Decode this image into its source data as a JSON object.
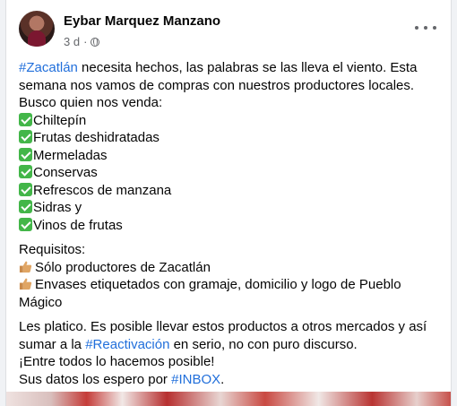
{
  "post": {
    "author": "Eybar Marquez Manzano",
    "time": "3 d",
    "dot": "·",
    "line1_tag": "#Zacatlán",
    "line1_rest": " necesita hechos, las palabras se las lleva el viento. Esta",
    "line2": "semana nos vamos de compras con nuestros productores locales.",
    "line3": "Busco quien nos venda:",
    "items": [
      "Chiltepín",
      "Frutas deshidratadas",
      "Mermeladas",
      "Conservas",
      "Refrescos de manzana",
      "Sidras y",
      "Vinos de frutas"
    ],
    "requirements_title": "Requisitos:",
    "req1": "Sólo productores de Zacatlán",
    "req2_line1": "Envases etiquetados con gramaje, domicilio y logo de Pueblo",
    "req2_line2": "Mágico",
    "p3_line1": "Les platico. Es posible llevar estos productos a otros mercados y así",
    "p3_line2_pre": "sumar a la ",
    "p3_line2_tag": "#Reactivación",
    "p3_line2_post": " en serio, no con puro discurso.",
    "p3_line3": "¡Entre todos lo hacemos posible!",
    "p3_line4_pre": "Sus datos los espero por ",
    "p3_line4_tag": "#INBOX",
    "p3_line4_post": "."
  },
  "colors": {
    "hashtag": "#216fdb",
    "check": "#43b649",
    "meta": "#65676b"
  },
  "icons": {
    "privacy": "globe-icon",
    "menu": "more-options-icon",
    "check": "check-mark-icon",
    "thumb": "thumbs-up-icon"
  }
}
